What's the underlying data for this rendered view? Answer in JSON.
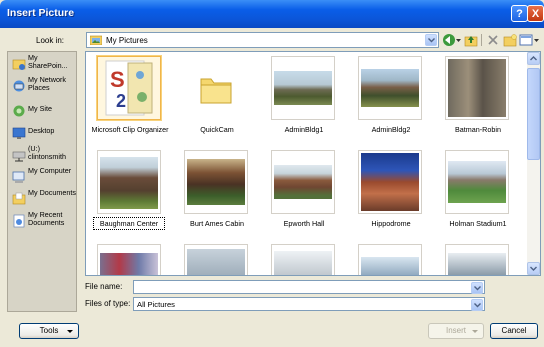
{
  "window": {
    "title": "Insert Picture",
    "help_glyph": "?",
    "close_glyph": "X"
  },
  "look_in": {
    "label": "Look in:",
    "value": "My Pictures"
  },
  "places": [
    {
      "label": "My SharePoin...",
      "icon": "sharepoint-icon"
    },
    {
      "label": "My Network Places",
      "icon": "network-places-icon"
    },
    {
      "label": "My Site",
      "icon": "my-site-icon"
    },
    {
      "label": "Desktop",
      "icon": "desktop-icon"
    },
    {
      "label": "(U:) clintonsmith",
      "icon": "network-drive-icon"
    },
    {
      "label": "My Computer",
      "icon": "computer-icon"
    },
    {
      "label": "My Documents",
      "icon": "documents-icon"
    },
    {
      "label": "My Recent Documents",
      "icon": "recent-documents-icon"
    }
  ],
  "files": [
    {
      "name": "Microsoft Clip Organizer",
      "kind": "clip-organizer"
    },
    {
      "name": "QuickCam",
      "kind": "folder"
    },
    {
      "name": "AdminBldg1",
      "kind": "photo"
    },
    {
      "name": "AdminBldg2",
      "kind": "photo"
    },
    {
      "name": "Batman-Robin",
      "kind": "photo"
    },
    {
      "name": "Baughman Center",
      "kind": "photo",
      "selected": true
    },
    {
      "name": "Burt Ames Cabin",
      "kind": "photo"
    },
    {
      "name": "Epworth Hall",
      "kind": "photo"
    },
    {
      "name": "Hippodrome",
      "kind": "photo"
    },
    {
      "name": "Holman Stadium1",
      "kind": "photo"
    },
    {
      "name": "",
      "kind": "photo"
    },
    {
      "name": "",
      "kind": "photo"
    },
    {
      "name": "",
      "kind": "photo"
    },
    {
      "name": "",
      "kind": "photo"
    },
    {
      "name": "",
      "kind": "photo"
    }
  ],
  "file_name": {
    "label": "File name:",
    "value": ""
  },
  "file_type": {
    "label": "Files of type:",
    "value": "All Pictures"
  },
  "buttons": {
    "tools": "Tools",
    "insert": "Insert",
    "cancel": "Cancel"
  }
}
